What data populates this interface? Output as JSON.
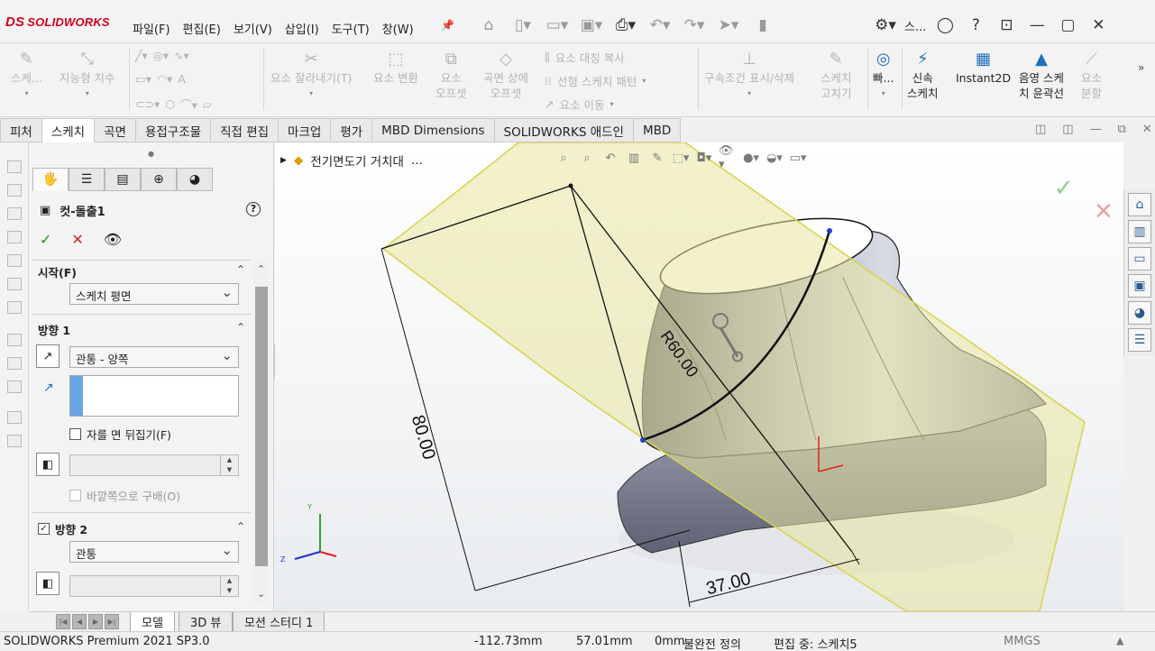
{
  "app": {
    "logo_prefix": "DS",
    "logo_text": "SOLIDWORKS"
  },
  "menu": [
    "파일(F)",
    "편집(E)",
    "보기(V)",
    "삽입(I)",
    "도구(T)",
    "창(W)"
  ],
  "quick_icons": [
    "home-icon",
    "new-icon",
    "open-icon",
    "save-icon",
    "print-icon",
    "undo-icon",
    "redo-icon",
    "pointer-icon",
    "rebuild-icon",
    "options-icon"
  ],
  "topright": {
    "search_label": "스...",
    "icons": [
      "user-icon",
      "help-icon",
      "restore-window-icon",
      "minimize-icon",
      "maximize-icon",
      "close-icon"
    ]
  },
  "commands": {
    "sketch": "스케...",
    "smart_dim": "지능형 치수",
    "trim": "요소 잘라내기(T)",
    "convert": "요소 변환",
    "offset_top": "요소",
    "offset_bottom": "오프셋",
    "surf_offset_top": "곡면 상에",
    "surf_offset_bottom": "오프셋",
    "mirror": "요소 대칭 복사",
    "linear_pattern": "선형 스케치 패턴",
    "move": "요소 이동",
    "relations": "구속조건 표시/삭제",
    "repair_top": "스케치",
    "repair_bottom": "고치기",
    "quick_snap": "빠...",
    "rapid_top": "신속",
    "rapid_bottom": "스케치",
    "instant2d": "Instant2D",
    "shaded_top": "음영 스케",
    "shaded_bottom": "치 윤곽선",
    "split_top": "요소",
    "split_bottom": "분할"
  },
  "tabs": [
    "피처",
    "스케치",
    "곡면",
    "용접구조물",
    "직접 편집",
    "마크업",
    "평가",
    "MBD Dimensions",
    "SOLIDWORKS 애드인",
    "MBD"
  ],
  "active_tab": "스케치",
  "property_manager": {
    "feature_title": "컷-돌출1",
    "help": "?",
    "ok": "✓",
    "cancel": "✕",
    "preview": "👁",
    "start": {
      "heading": "시작(F)",
      "value": "스케치 평면"
    },
    "direction1": {
      "heading": "방향 1",
      "end_condition": "관통 - 양쪽",
      "flip_side": "자를 면 뒤집기(F)",
      "draft_outward": "바깥쪽으로 구배(O)"
    },
    "direction2": {
      "heading": "방향 2",
      "end_condition": "관통"
    }
  },
  "viewport": {
    "breadcrumb": "전기면도기 거치대",
    "ellipsis": "...",
    "dims": {
      "radius": "R60.00",
      "length": "80.00",
      "width": "37.00"
    },
    "axis_labels": {
      "y": "Y",
      "z": "Z"
    }
  },
  "bottom_tabs": [
    "모델",
    "3D 뷰",
    "모션 스터디 1"
  ],
  "active_bottom_tab": "모델",
  "status": {
    "product": "SOLIDWORKS Premium 2021 SP3.0",
    "x": "-112.73mm",
    "y": "57.01mm",
    "z": "0mm",
    "definition": "불완전 정의",
    "editing": "편집 중: 스케치5",
    "units": "MMGS"
  },
  "colors": {
    "brand": "#d0021b",
    "plane_fill": "#e8e6a0",
    "plane_edge": "#d9d34a",
    "part_body": "#8e93a6",
    "selection_blue": "#6aa5e8"
  }
}
